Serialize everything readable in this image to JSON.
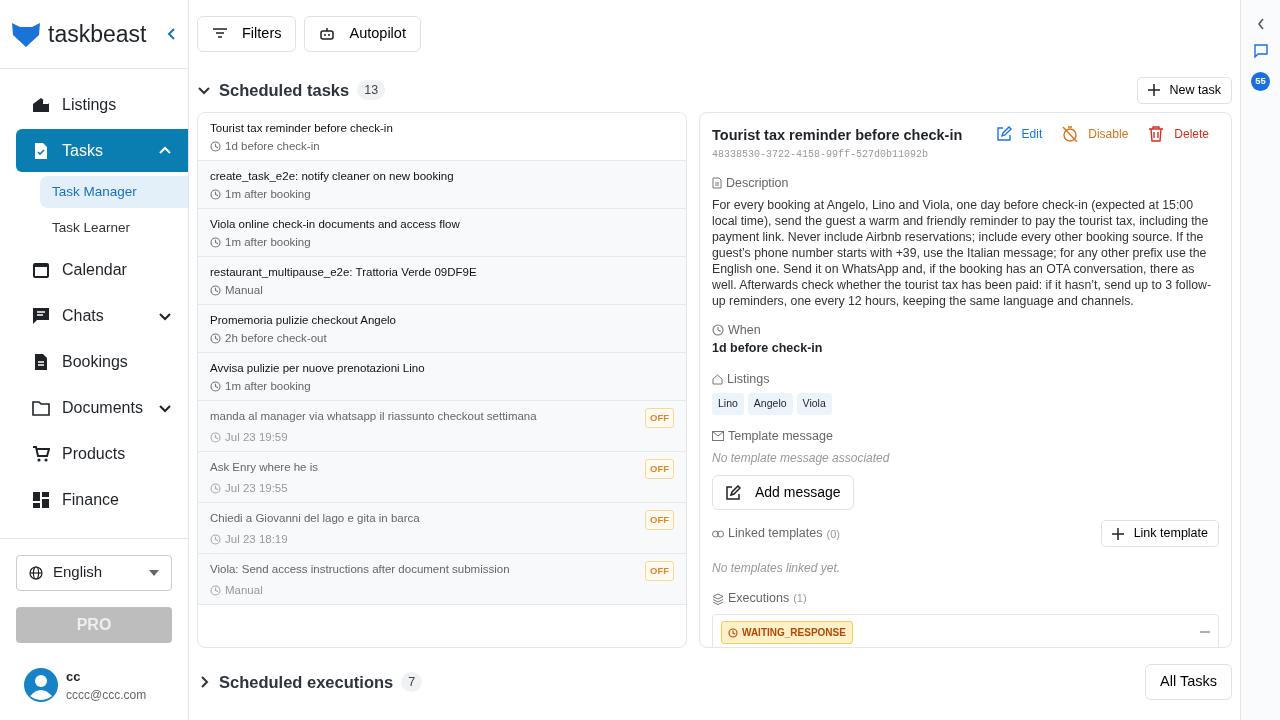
{
  "brand": {
    "name": "taskbeast"
  },
  "nav": [
    {
      "label": "Listings",
      "selected": false
    },
    {
      "label": "Tasks",
      "selected": true,
      "expanded": true,
      "children": [
        {
          "label": "Task Manager",
          "selected": true
        },
        {
          "label": "Task Learner",
          "selected": false
        }
      ]
    },
    {
      "label": "Calendar",
      "selected": false
    },
    {
      "label": "Chats",
      "selected": false,
      "expanded": false
    },
    {
      "label": "Bookings",
      "selected": false
    },
    {
      "label": "Documents",
      "selected": false,
      "expanded": false
    },
    {
      "label": "Products",
      "selected": false
    },
    {
      "label": "Finance",
      "selected": false
    }
  ],
  "language": {
    "value": "English"
  },
  "pro_button": {
    "label": "PRO",
    "disabled": true
  },
  "user": {
    "name": "cc",
    "email": "cccc@ccc.com"
  },
  "toolbar": [
    {
      "label": "Filters"
    },
    {
      "label": "Autopilot"
    }
  ],
  "scheduled_tasks": {
    "title": "Scheduled tasks",
    "count": "13",
    "expanded": true,
    "new_button": "New task",
    "items": [
      {
        "title": "Tourist tax reminder before check-in",
        "trigger": "1d before check-in",
        "selected": true,
        "off": false
      },
      {
        "title": "create_task_e2e: notify cleaner on new booking",
        "trigger": "1m after booking",
        "selected": false,
        "off": false
      },
      {
        "title": "Viola online check-in documents and access flow",
        "trigger": "1m after booking",
        "selected": false,
        "off": false
      },
      {
        "title": "restaurant_multipause_e2e: Trattoria Verde 09DF9E",
        "trigger": "Manual",
        "selected": false,
        "off": false
      },
      {
        "title": "Promemoria pulizie checkout Angelo",
        "trigger": "2h before check-out",
        "selected": false,
        "off": false
      },
      {
        "title": "Avvisa pulizie per nuove prenotazioni Lino",
        "trigger": "1m after booking",
        "selected": false,
        "off": false
      },
      {
        "title": "manda al manager via whatsapp il riassunto checkout settimana",
        "trigger": "Jul 23 19:59",
        "selected": false,
        "off": true,
        "badge": "OFF"
      },
      {
        "title": "Ask Enry where he is",
        "trigger": "Jul 23 19:55",
        "selected": false,
        "off": true,
        "badge": "OFF"
      },
      {
        "title": "Chiedi a Giovanni del lago e gita in barca",
        "trigger": "Jul 23 18:19",
        "selected": false,
        "off": true,
        "badge": "OFF"
      },
      {
        "title": "Viola: Send access instructions after document submission",
        "trigger": "Manual",
        "selected": false,
        "off": true,
        "badge": "OFF"
      }
    ]
  },
  "detail": {
    "title": "Tourist tax reminder before check-in",
    "id": "48338530-3722-4158-99ff-527d0b11092b",
    "actions": [
      {
        "kind": "edit",
        "label": "Edit"
      },
      {
        "kind": "disable",
        "label": "Disable"
      },
      {
        "kind": "delete",
        "label": "Delete"
      }
    ],
    "description_label": "Description",
    "description": "For every booking at Angelo, Lino and Viola, one day before check-in (expected at 15:00 local time), send the guest a warm and friendly reminder to pay the tourist tax, including the payment link. Never include Airbnb reservations; include every other booking source. If the guest’s phone number starts with +39, use the Italian message; for any other prefix use the English one. Send it on WhatsApp and, if the booking has an OTA conversation, there as well. Afterwards check whether the tourist tax has been paid: if it hasn’t, send up to 3 follow-up reminders, one every 12 hours, keeping the same language and channels.",
    "when_label": "When",
    "when": "1d before check-in",
    "listings_label": "Listings",
    "listings": [
      "Lino",
      "Angelo",
      "Viola"
    ],
    "template_label": "Template message",
    "template_empty": "No template message associated",
    "add_message": "Add message",
    "linked_label": "Linked templates",
    "linked_count": "(0)",
    "link_button": "Link template",
    "linked_empty": "No templates linked yet.",
    "executions_label": "Executions",
    "executions_count": "(1)",
    "executions": [
      {
        "status": "WAITING_RESPONSE",
        "expanded": true
      }
    ]
  },
  "scheduled_executions": {
    "title": "Scheduled executions",
    "count": "7",
    "expanded": false,
    "all_button": "All Tasks"
  },
  "rail": {
    "badge": "55"
  }
}
